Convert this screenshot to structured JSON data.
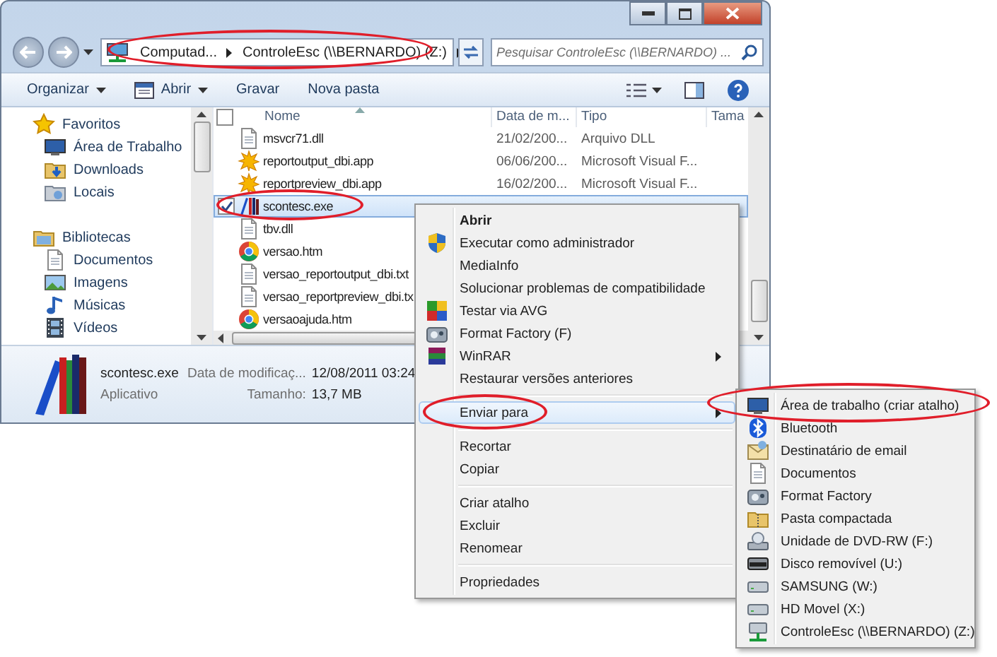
{
  "address": {
    "crumbs": [
      "Computad...",
      "ControleEsc (\\\\BERNARDO) (Z:)"
    ],
    "highlighted": true
  },
  "search": {
    "placeholder": "Pesquisar ControleEsc (\\\\BERNARDO) ..."
  },
  "toolbar": [
    {
      "label": "Organizar",
      "dropdown": true
    },
    {
      "label": "Abrir",
      "dropdown": true
    },
    {
      "label": "Gravar",
      "dropdown": false
    },
    {
      "label": "Nova pasta",
      "dropdown": false
    }
  ],
  "sidebar": [
    {
      "label": "Favoritos",
      "children": [
        {
          "label": "Área de Trabalho"
        },
        {
          "label": "Downloads"
        },
        {
          "label": "Locais"
        }
      ]
    },
    {
      "label": "Bibliotecas",
      "children": [
        {
          "label": "Documentos"
        },
        {
          "label": "Imagens"
        },
        {
          "label": "Músicas"
        },
        {
          "label": "Vídeos"
        }
      ]
    }
  ],
  "select_all": {
    "checked": false
  },
  "columns": [
    "Nome",
    "Data de m...",
    "Tipo",
    "Tama"
  ],
  "files": [
    {
      "name": "msvcr71.dll",
      "date": "21/02/200...",
      "type": "Arquivo DLL",
      "selected": false,
      "checked": false,
      "highlighted": false
    },
    {
      "name": "reportoutput_dbi.app",
      "date": "06/06/200...",
      "type": "Microsoft Visual F...",
      "selected": false,
      "checked": false,
      "highlighted": false
    },
    {
      "name": "reportpreview_dbi.app",
      "date": "16/02/200...",
      "type": "Microsoft Visual F...",
      "selected": false,
      "checked": false,
      "highlighted": false
    },
    {
      "name": "scontesc.exe",
      "selected": true,
      "checked": true,
      "highlighted": true
    },
    {
      "name": "tbv.dll",
      "selected": false,
      "checked": false,
      "highlighted": false
    },
    {
      "name": "versao.htm",
      "selected": false,
      "checked": false,
      "highlighted": false
    },
    {
      "name": "versao_reportoutput_dbi.txt",
      "selected": false,
      "checked": false,
      "highlighted": false
    },
    {
      "name": "versao_reportpreview_dbi.tx",
      "selected": false,
      "checked": false,
      "highlighted": false
    },
    {
      "name": "versaoajuda.htm",
      "selected": false,
      "checked": false,
      "highlighted": false
    }
  ],
  "details": {
    "name": "scontesc.exe",
    "type": "Aplicativo",
    "fields": [
      {
        "label": "Data de modificaç...",
        "value": "12/08/2011 03:24"
      },
      {
        "label": "Tamanho:",
        "value": "13,7 MB"
      }
    ]
  },
  "context_menu": {
    "selected_circled": true,
    "groups": [
      [
        {
          "label": "Abrir",
          "bold": true,
          "submenu": false,
          "selected": false
        },
        {
          "label": "Executar como administrador",
          "bold": false,
          "submenu": false,
          "selected": false
        },
        {
          "label": "MediaInfo",
          "bold": false,
          "submenu": false,
          "selected": false
        },
        {
          "label": "Solucionar problemas de compatibilidade",
          "bold": false,
          "submenu": false,
          "selected": false
        },
        {
          "label": "Testar via  AVG",
          "bold": false,
          "submenu": false,
          "selected": false
        },
        {
          "label": "Format Factory (F)",
          "bold": false,
          "submenu": false,
          "selected": false
        },
        {
          "label": "WinRAR",
          "bold": false,
          "submenu": true,
          "selected": false
        },
        {
          "label": "Restaurar versões anteriores",
          "bold": false,
          "submenu": false,
          "selected": false
        }
      ],
      [
        {
          "label": "Enviar para",
          "bold": false,
          "submenu": true,
          "selected": true
        }
      ],
      [
        {
          "label": "Recortar",
          "bold": false,
          "submenu": false,
          "selected": false
        },
        {
          "label": "Copiar",
          "bold": false,
          "submenu": false,
          "selected": false
        }
      ],
      [
        {
          "label": "Criar atalho",
          "bold": false,
          "submenu": false,
          "selected": false
        },
        {
          "label": "Excluir",
          "bold": false,
          "submenu": false,
          "selected": false
        },
        {
          "label": "Renomear",
          "bold": false,
          "submenu": false,
          "selected": false
        }
      ],
      [
        {
          "label": "Propriedades",
          "bold": false,
          "submenu": false,
          "selected": false
        }
      ]
    ]
  },
  "send_to": [
    {
      "label": "Área de trabalho (criar atalho)",
      "highlighted": true
    },
    {
      "label": "Bluetooth",
      "highlighted": false
    },
    {
      "label": "Destinatário de email",
      "highlighted": false
    },
    {
      "label": "Documentos",
      "highlighted": false
    },
    {
      "label": "Format Factory",
      "highlighted": false
    },
    {
      "label": "Pasta compactada",
      "highlighted": false
    },
    {
      "label": "Unidade de DVD-RW (F:)",
      "highlighted": false
    },
    {
      "label": "Disco removível (U:)",
      "highlighted": false
    },
    {
      "label": "SAMSUNG (W:)",
      "highlighted": false
    },
    {
      "label": "HD Movel (X:)",
      "highlighted": false
    },
    {
      "label": "ControleEsc (\\\\BERNARDO) (Z:)",
      "highlighted": false
    }
  ]
}
